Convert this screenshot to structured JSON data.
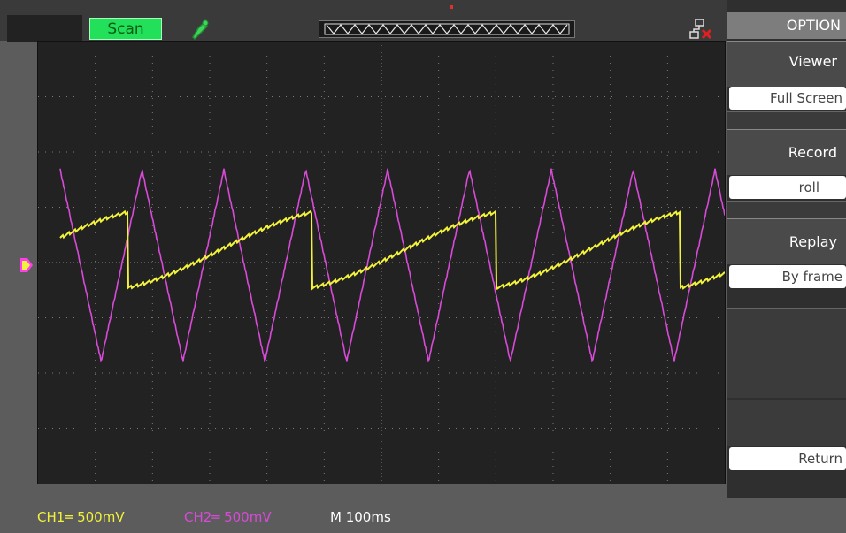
{
  "toolbar": {
    "mode_label": "Scan",
    "colors": {
      "mode_bg": "#22e05a",
      "trigger_marker": "#e03030"
    }
  },
  "side_panel": {
    "title": "OPTION",
    "viewer_label": "Viewer",
    "viewer_value": "Full Screen",
    "record_label": "Record",
    "record_value": "roll",
    "replay_label": "Replay",
    "replay_value": "By frame",
    "return_label": "Return"
  },
  "status": {
    "ch1_text": "CH1═ 500mV",
    "ch2_text": "CH2═ 500mV",
    "timebase_text": "M 100ms",
    "colors": {
      "ch1": "#f2f23a",
      "ch2": "#d84ad8",
      "timebase": "#ffffff"
    }
  },
  "icons": [
    "probe-icon",
    "network-disconnected-icon",
    "channel-1-marker-icon"
  ],
  "traces": {
    "ch1_color": "#f2f23a",
    "ch2_color": "#d84ad8",
    "ch1_shape": "sawtooth",
    "ch2_shape": "triangle"
  }
}
